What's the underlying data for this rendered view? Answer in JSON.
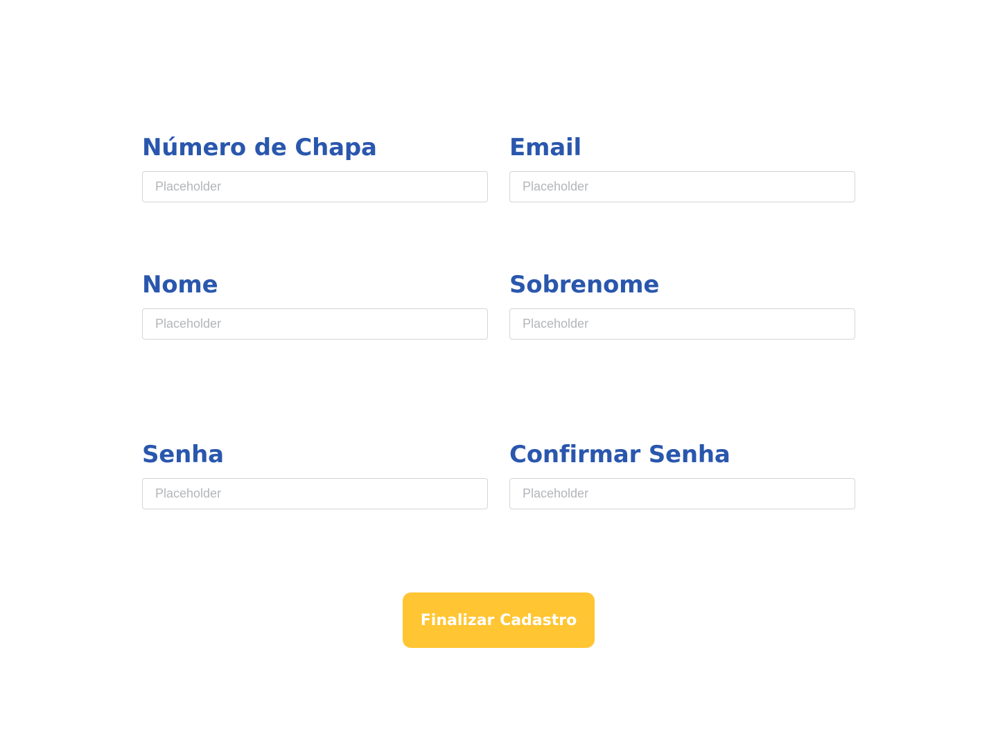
{
  "form": {
    "fields": [
      {
        "label": "Número de Chapa",
        "placeholder": "Placeholder",
        "value": ""
      },
      {
        "label": "Email",
        "placeholder": "Placeholder",
        "value": ""
      },
      {
        "label": "Nome",
        "placeholder": "Placeholder",
        "value": ""
      },
      {
        "label": "Sobrenome",
        "placeholder": "Placeholder",
        "value": ""
      },
      {
        "label": "Senha",
        "placeholder": "Placeholder",
        "value": ""
      },
      {
        "label": "Confirmar Senha",
        "placeholder": "Placeholder",
        "value": ""
      }
    ],
    "submit_label": "Finalizar Cadastro"
  },
  "colors": {
    "label": "#2A57AD",
    "button_background": "#FFC532",
    "button_text": "#FFFFFF",
    "input_border": "#D2D4D8",
    "placeholder_text": "#B3B5BA"
  }
}
